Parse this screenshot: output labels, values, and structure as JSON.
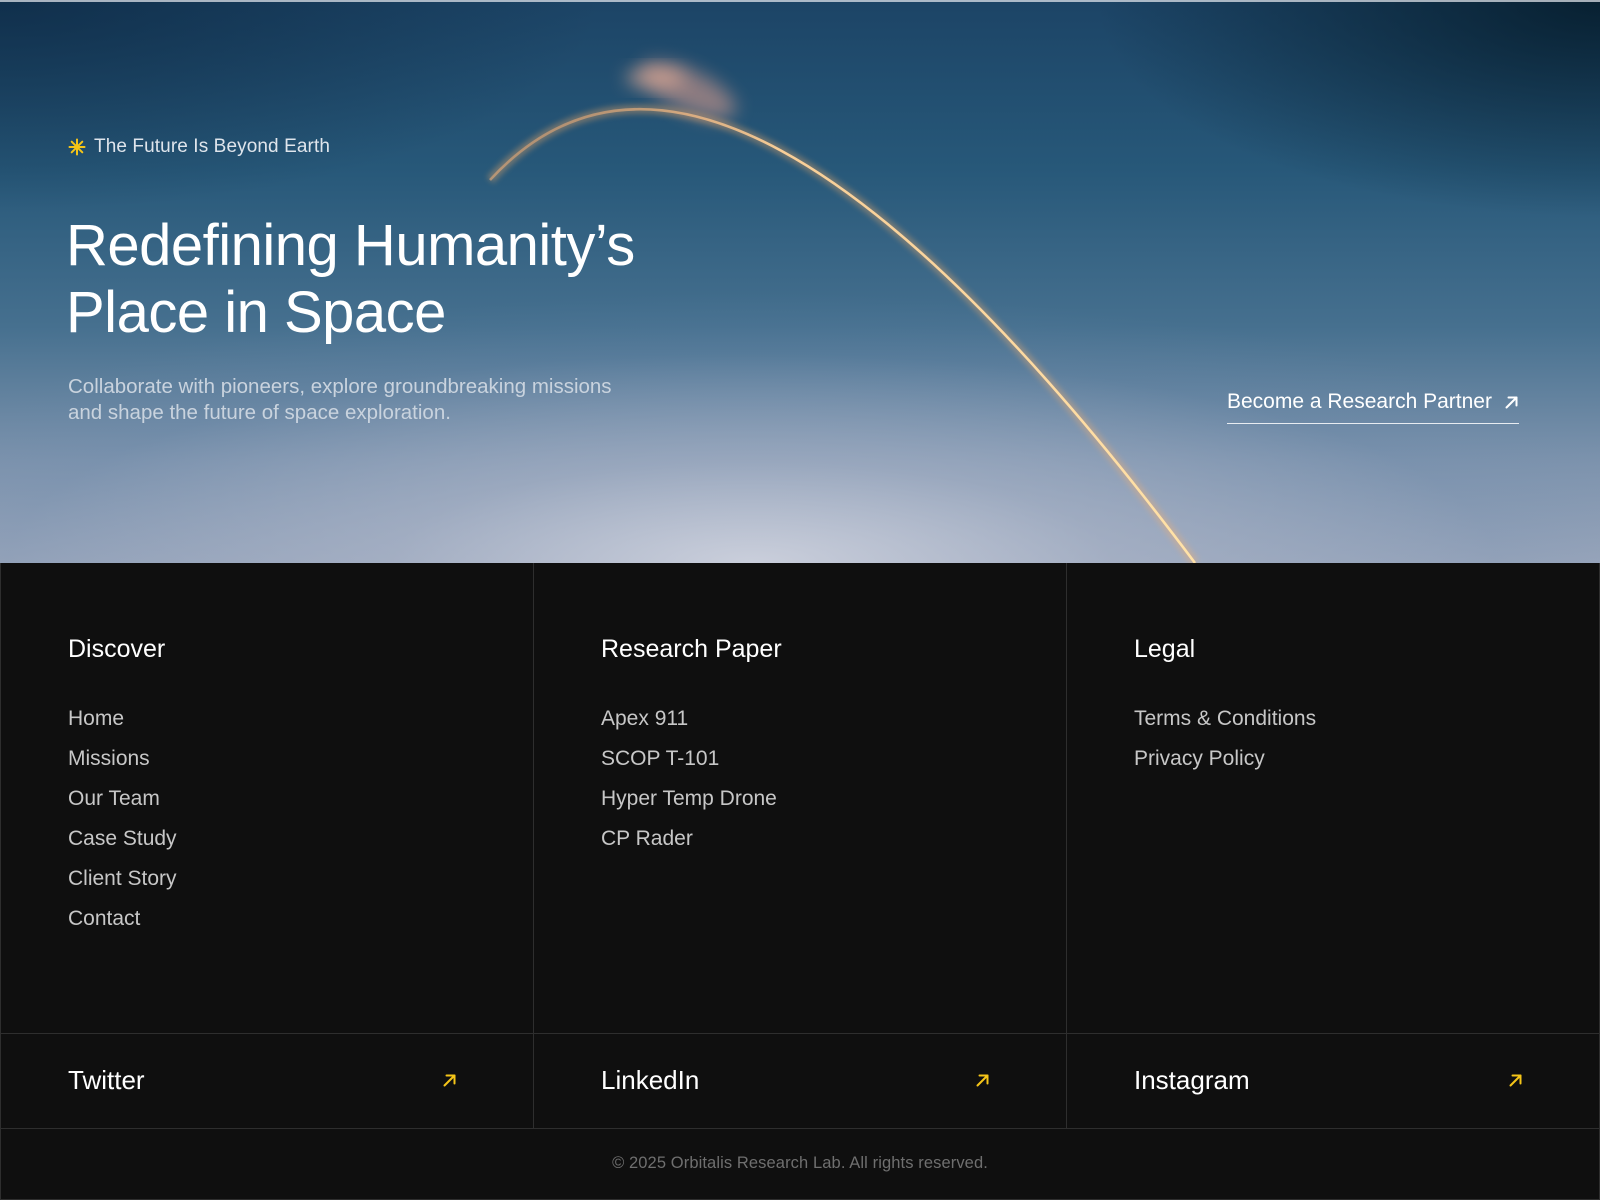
{
  "hero": {
    "tagline": "The Future Is Beyond Earth",
    "title_line1": "Redefining Humanity’s",
    "title_line2": "Place in Space",
    "subtitle_line1": "Collaborate with pioneers, explore groundbreaking missions",
    "subtitle_line2": "and shape the future of space exploration.",
    "cta_label": "Become a Research Partner",
    "cta_icon": "arrow-up-right-icon",
    "tagline_icon": "sparkle-icon"
  },
  "footer": {
    "columns": [
      {
        "heading": "Discover",
        "links": [
          "Home",
          "Missions",
          "Our Team",
          "Case Study",
          "Client Story",
          "Contact"
        ]
      },
      {
        "heading": "Research Paper",
        "links": [
          "Apex 911",
          "SCOP T-101",
          "Hyper Temp Drone",
          "CP Rader"
        ]
      },
      {
        "heading": "Legal",
        "links": [
          "Terms & Conditions",
          "Privacy Policy"
        ]
      }
    ],
    "socials": [
      {
        "label": "Twitter",
        "icon": "arrow-up-right-icon"
      },
      {
        "label": "LinkedIn",
        "icon": "arrow-up-right-icon"
      },
      {
        "label": "Instagram",
        "icon": "arrow-up-right-icon"
      }
    ],
    "copyright": "© 2025 Orbitalis Research Lab. All rights reserved."
  },
  "colors": {
    "accent_yellow": "#f5c518",
    "background_dark": "#0f0f0f",
    "divider": "#2e2e2e",
    "muted_text": "#c7c7c7"
  }
}
